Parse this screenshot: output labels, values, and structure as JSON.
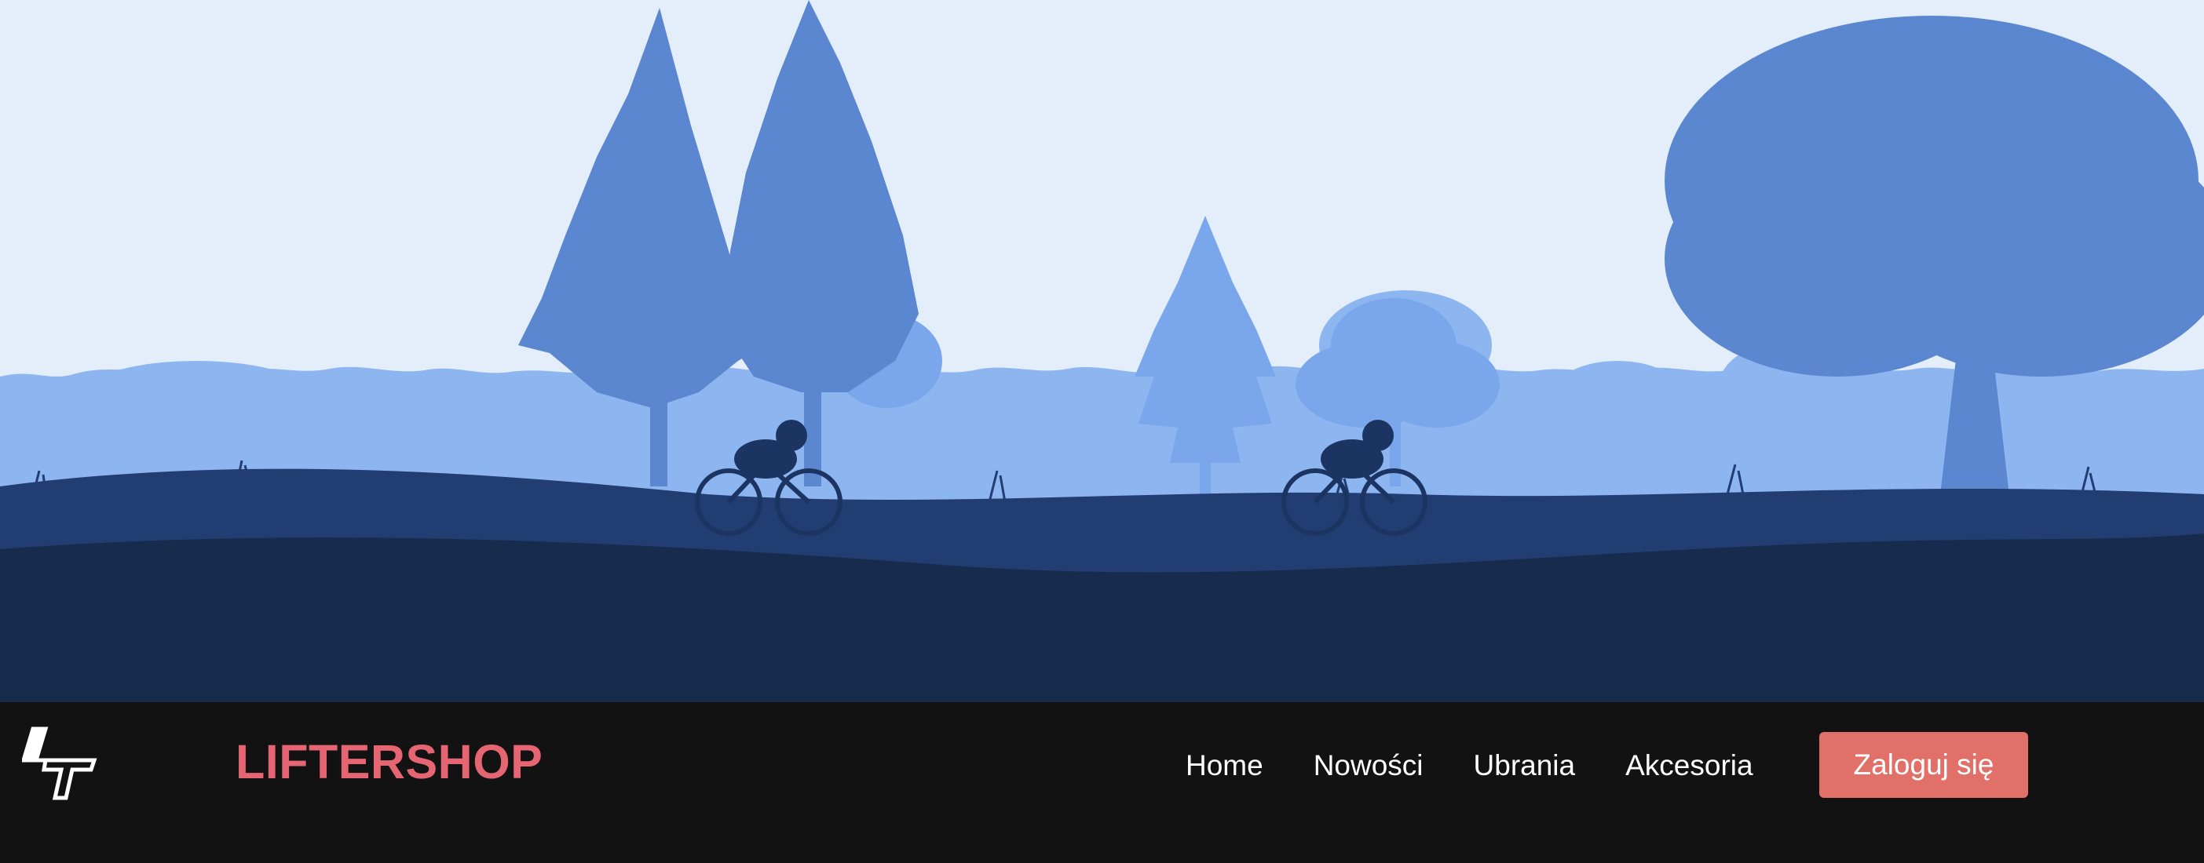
{
  "hero": {
    "image_description_icon": "forest-cyclists-illustration",
    "colors": {
      "sky": "#e3eefa",
      "far_trees": "#8db5f0",
      "mid_trees": "#5b87d0",
      "ground": "#223d72",
      "ground_dark": "#172b4d"
    }
  },
  "navbar": {
    "logo_icon": "lt-monogram-logo",
    "brand": "LIFTERSHOP",
    "links": [
      {
        "label": "Home"
      },
      {
        "label": "Nowości"
      },
      {
        "label": "Ubrania"
      },
      {
        "label": "Akcesoria"
      }
    ],
    "login_label": "Zaloguj się",
    "colors": {
      "background": "#121212",
      "brand": "#e66572",
      "button": "#e07068"
    }
  }
}
